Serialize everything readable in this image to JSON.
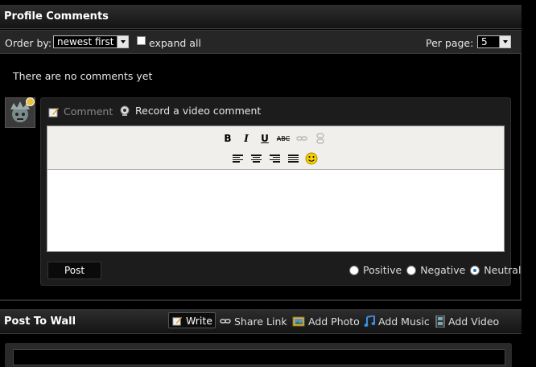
{
  "profile_comments": {
    "title": "Profile Comments",
    "order_by_label": "Order by:",
    "order_by_value": "newest first",
    "expand_all_label": "expand all",
    "per_page_label": "Per page:",
    "per_page_value": "5",
    "empty_message": "There are no comments yet"
  },
  "comment_box": {
    "comment_tab": "Comment",
    "video_tab": "Record a video comment",
    "toolbar": {
      "bold": "B",
      "italic": "I",
      "underline": "U",
      "strike": "ABC"
    },
    "post_label": "Post",
    "ratings": [
      "Positive",
      "Negative",
      "Neutral"
    ],
    "selected_rating": "Neutral"
  },
  "wall": {
    "title": "Post To Wall",
    "tabs": [
      "Write",
      "Share Link",
      "Add Photo",
      "Add Music",
      "Add Video"
    ]
  },
  "colors": {
    "background": "#000000",
    "panel": "#1c1c1c",
    "accent_avatar_badge": "#e8c23a"
  }
}
